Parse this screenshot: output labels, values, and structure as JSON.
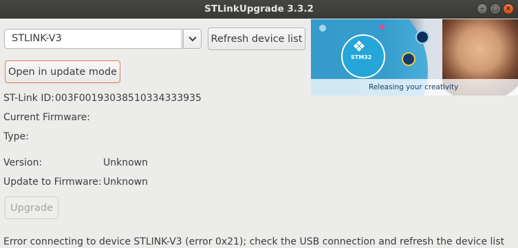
{
  "window": {
    "title": "STLinkUpgrade 3.3.2"
  },
  "device": {
    "selected": "STLINK-V3",
    "refresh_label": "Refresh device list"
  },
  "actions": {
    "update_mode_label": "Open in update mode",
    "upgrade_label": "Upgrade"
  },
  "info": {
    "stlink_id_label": "ST-Link ID:",
    "stlink_id_value": "003F00193038510334333935",
    "current_firmware_label": "Current Firmware:",
    "type_label": "Type:",
    "version_label": "Version:",
    "version_value": "Unknown",
    "update_to_label": "Update to Firmware:",
    "update_to_value": "Unknown"
  },
  "banner": {
    "logo_text": "STM32",
    "tagline": "Releasing your creativity"
  },
  "status": {
    "error": "Error connecting to device STLINK-V3 (error 0x21); check the USB connection and refresh the device list"
  },
  "colors": {
    "accent_border": "#e07a52",
    "close_button": "#e05a1e",
    "titlebar": "#3e3e3a"
  }
}
